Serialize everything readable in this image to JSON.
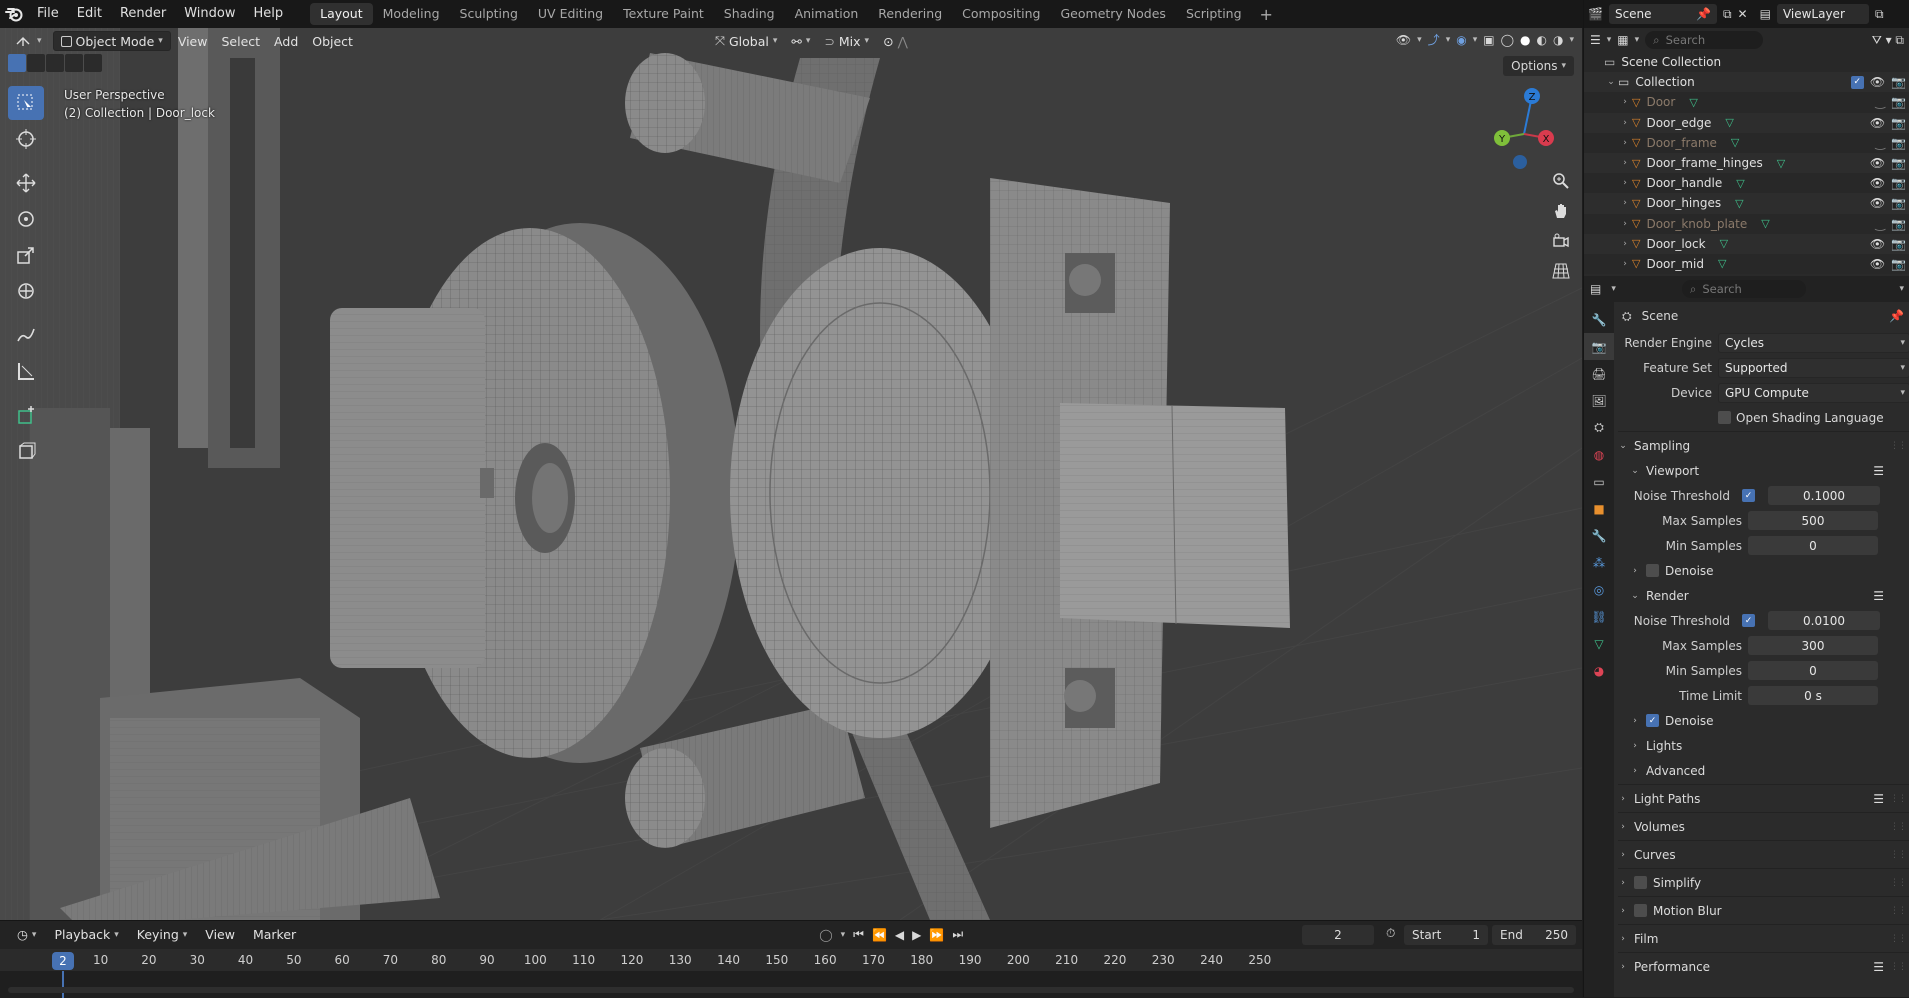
{
  "topbar": {
    "menus": [
      "File",
      "Edit",
      "Render",
      "Window",
      "Help"
    ],
    "workspaces": [
      "Layout",
      "Modeling",
      "Sculpting",
      "UV Editing",
      "Texture Paint",
      "Shading",
      "Animation",
      "Rendering",
      "Compositing",
      "Geometry Nodes",
      "Scripting"
    ],
    "active_workspace": "Layout",
    "add_tab": "+"
  },
  "viewport": {
    "mode": "Object Mode",
    "menus": [
      "View",
      "Select",
      "Add",
      "Object"
    ],
    "orientation": "Global",
    "snap_mode": "Mix",
    "options_label": "Options",
    "overlay_line1": "User Perspective",
    "overlay_line2": "(2) Collection | Door_lock",
    "gizmo": {
      "z": "Z",
      "y": "Y",
      "x": "X"
    }
  },
  "timeline": {
    "menus": [
      "Playback",
      "Keying",
      "View",
      "Marker"
    ],
    "current_frame": "2",
    "start_label": "Start",
    "start": "1",
    "end_label": "End",
    "end": "250",
    "ticks": [
      "10",
      "20",
      "30",
      "40",
      "50",
      "60",
      "70",
      "80",
      "90",
      "100",
      "110",
      "120",
      "130",
      "140",
      "150",
      "160",
      "170",
      "180",
      "190",
      "200",
      "210",
      "220",
      "230",
      "240",
      "250"
    ],
    "playhead": "2"
  },
  "right_top": {
    "scene": "Scene",
    "view_layer": "ViewLayer"
  },
  "outliner": {
    "search_placeholder": "Search",
    "scene_collection": "Scene Collection",
    "collection": "Collection",
    "items": [
      {
        "name": "Door",
        "dim": true
      },
      {
        "name": "Door_edge",
        "dim": false
      },
      {
        "name": "Door_frame",
        "dim": true
      },
      {
        "name": "Door_frame_hinges",
        "dim": false
      },
      {
        "name": "Door_handle",
        "dim": false
      },
      {
        "name": "Door_hinges",
        "dim": false
      },
      {
        "name": "Door_knob_plate",
        "dim": true
      },
      {
        "name": "Door_lock",
        "dim": false
      },
      {
        "name": "Door_mid",
        "dim": false
      }
    ]
  },
  "properties": {
    "search_placeholder": "Search",
    "context": "Scene",
    "render_engine_label": "Render Engine",
    "render_engine": "Cycles",
    "feature_set_label": "Feature Set",
    "feature_set": "Supported",
    "device_label": "Device",
    "device": "GPU Compute",
    "osl_label": "Open Shading Language",
    "sampling": "Sampling",
    "viewport": "Viewport",
    "noise_threshold_label": "Noise Threshold",
    "viewport_noise_threshold": "0.1000",
    "max_samples_label": "Max Samples",
    "viewport_max_samples": "500",
    "min_samples_label": "Min Samples",
    "viewport_min_samples": "0",
    "denoise": "Denoise",
    "render": "Render",
    "render_noise_threshold": "0.0100",
    "render_max_samples": "300",
    "render_min_samples": "0",
    "time_limit_label": "Time Limit",
    "time_limit": "0 s",
    "lights": "Lights",
    "advanced": "Advanced",
    "light_paths": "Light Paths",
    "volumes": "Volumes",
    "curves": "Curves",
    "simplify": "Simplify",
    "motion_blur": "Motion Blur",
    "film": "Film",
    "performance": "Performance"
  },
  "colors": {
    "accent": "#4772b3",
    "mesh_icon": "#d9822b",
    "data_icon": "#3fbf8a"
  }
}
